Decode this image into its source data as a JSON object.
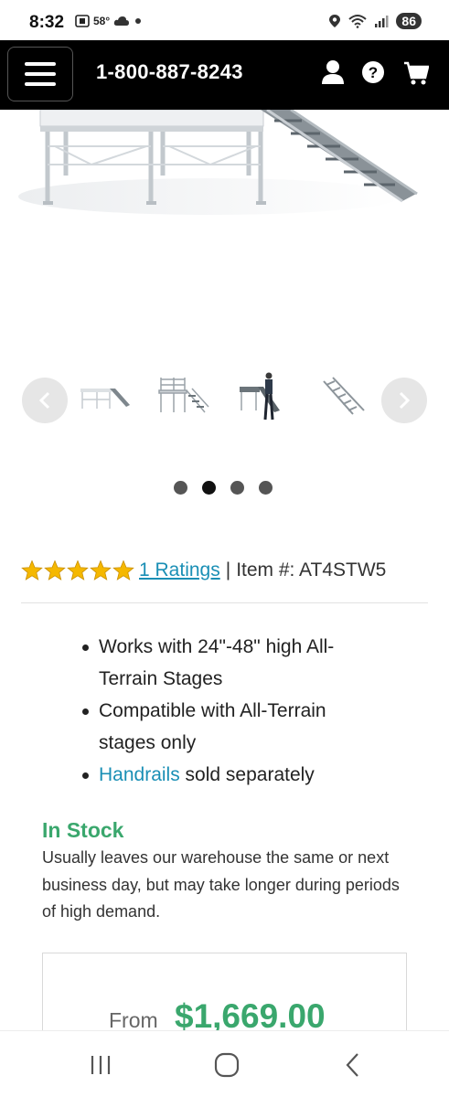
{
  "status": {
    "time": "8:32",
    "temp": "58°",
    "battery": "86"
  },
  "header": {
    "phone": "1-800-887-8243",
    "accent": "#000000"
  },
  "rating": {
    "stars": 5,
    "link_label": "1 Ratings",
    "separator": "|",
    "item_label": "Item #: AT4STW5",
    "star_color": "#f5b800",
    "link_color": "#1a8fb5"
  },
  "carousel": {
    "active_dot": 2,
    "dot_count": 4,
    "thumbnails": [
      "stage-stairs-thumb",
      "stage-railing-thumb",
      "person-on-stairs-thumb",
      "stairs-only-thumb"
    ]
  },
  "features": {
    "item1": "Works with 24\"-48\" high All-Terrain Stages",
    "item2": "Compatible with All-Terrain stages only",
    "item3_link": "Handrails",
    "item3_rest": " sold separately"
  },
  "stock": {
    "status": "In Stock",
    "status_color": "#3aa76d",
    "description": "Usually leaves our warehouse the same or next business day, but may take longer during periods of high demand."
  },
  "price": {
    "from_label": "From",
    "value": "$1,669.00"
  }
}
